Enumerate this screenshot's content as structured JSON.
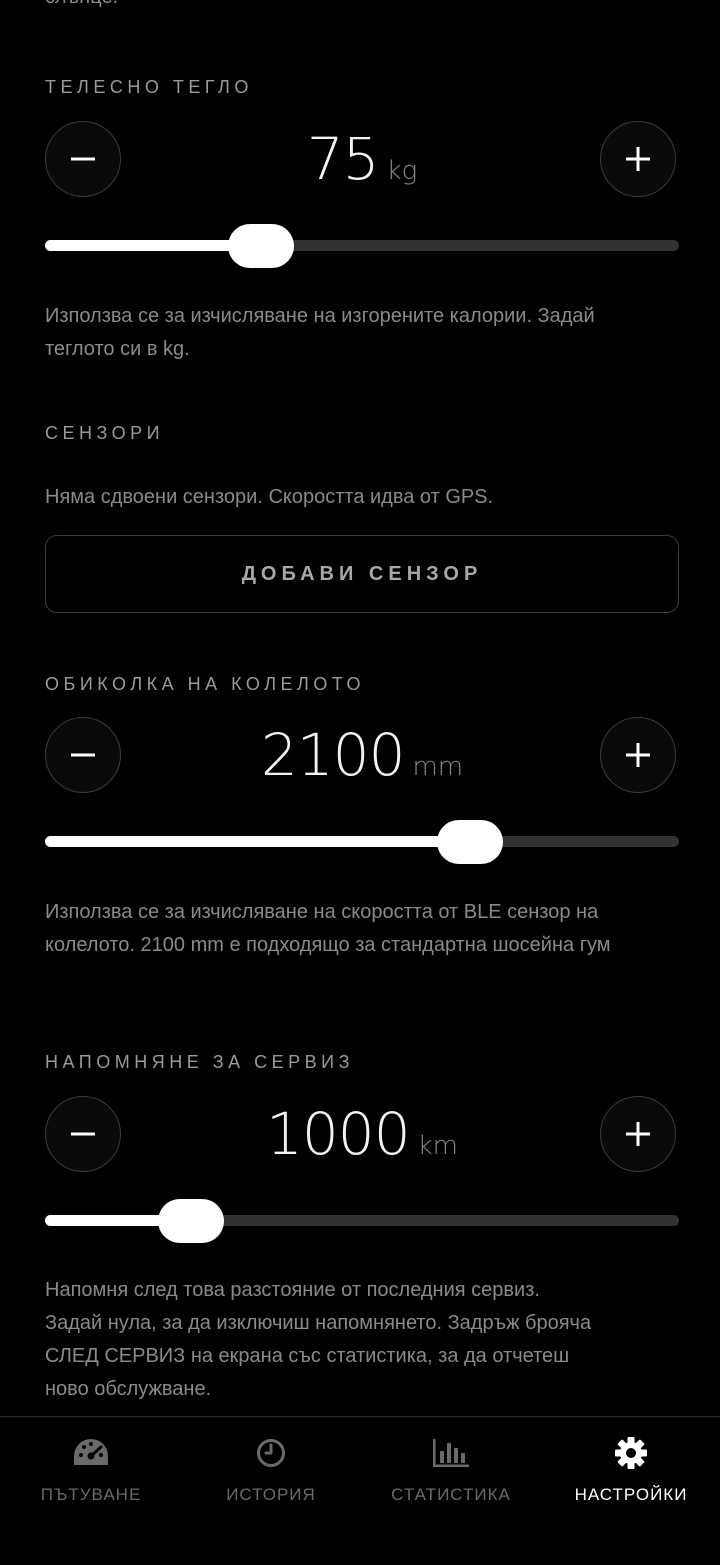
{
  "clipped_header_text": "слънце.",
  "weight": {
    "label": "ТЕЛЕСНО ТЕГЛО",
    "value": "75",
    "unit": "kg",
    "slider_fraction": 0.34,
    "help_line1": "Използва се за изчисляване на изгорените калории. Задай",
    "help_line2": "теглото си в kg."
  },
  "sensors": {
    "label": "СЕНЗОРИ",
    "status_text": "Няма сдвоени сензори. Скоростта идва от GPS.",
    "add_button_label": "ДОБАВИ СЕНЗОР"
  },
  "wheel": {
    "label": "ОБИКОЛКА НА КОЛЕЛОТО",
    "value": "2100",
    "unit": "mm",
    "slider_fraction": 0.67,
    "help_line1": "Използва се за изчисляване на скоростта от BLE сензор на",
    "help_line2": "колелото. 2100 mm е подходящо за стандартна шосейна гум"
  },
  "service": {
    "label": "НАПОМНЯНЕ ЗА СЕРВИЗ",
    "value": "1000",
    "unit": "km",
    "slider_fraction": 0.23,
    "help_line1": "Напомня след това разстояние от последния сервиз.",
    "help_line2": "Задай нула, за да изключиш напомнянето. Задръж брояча",
    "help_line3": "СЛЕД СЕРВИЗ на екрана със статистика, за да отчетеш",
    "help_line4": "ново обслужване."
  },
  "tabs": [
    {
      "label": "ПЪТУВАНЕ",
      "icon": "speedometer-icon",
      "active": false
    },
    {
      "label": "ИСТОРИЯ",
      "icon": "clock-icon",
      "active": false
    },
    {
      "label": "СТАТИСТИКА",
      "icon": "bar-chart-icon",
      "active": false
    },
    {
      "label": "НАСТРОЙКИ",
      "icon": "gear-icon",
      "active": true
    }
  ],
  "colors": {
    "background": "#000000",
    "muted_text": "#8a8a8a",
    "track": "#333333",
    "active": "#ffffff"
  }
}
